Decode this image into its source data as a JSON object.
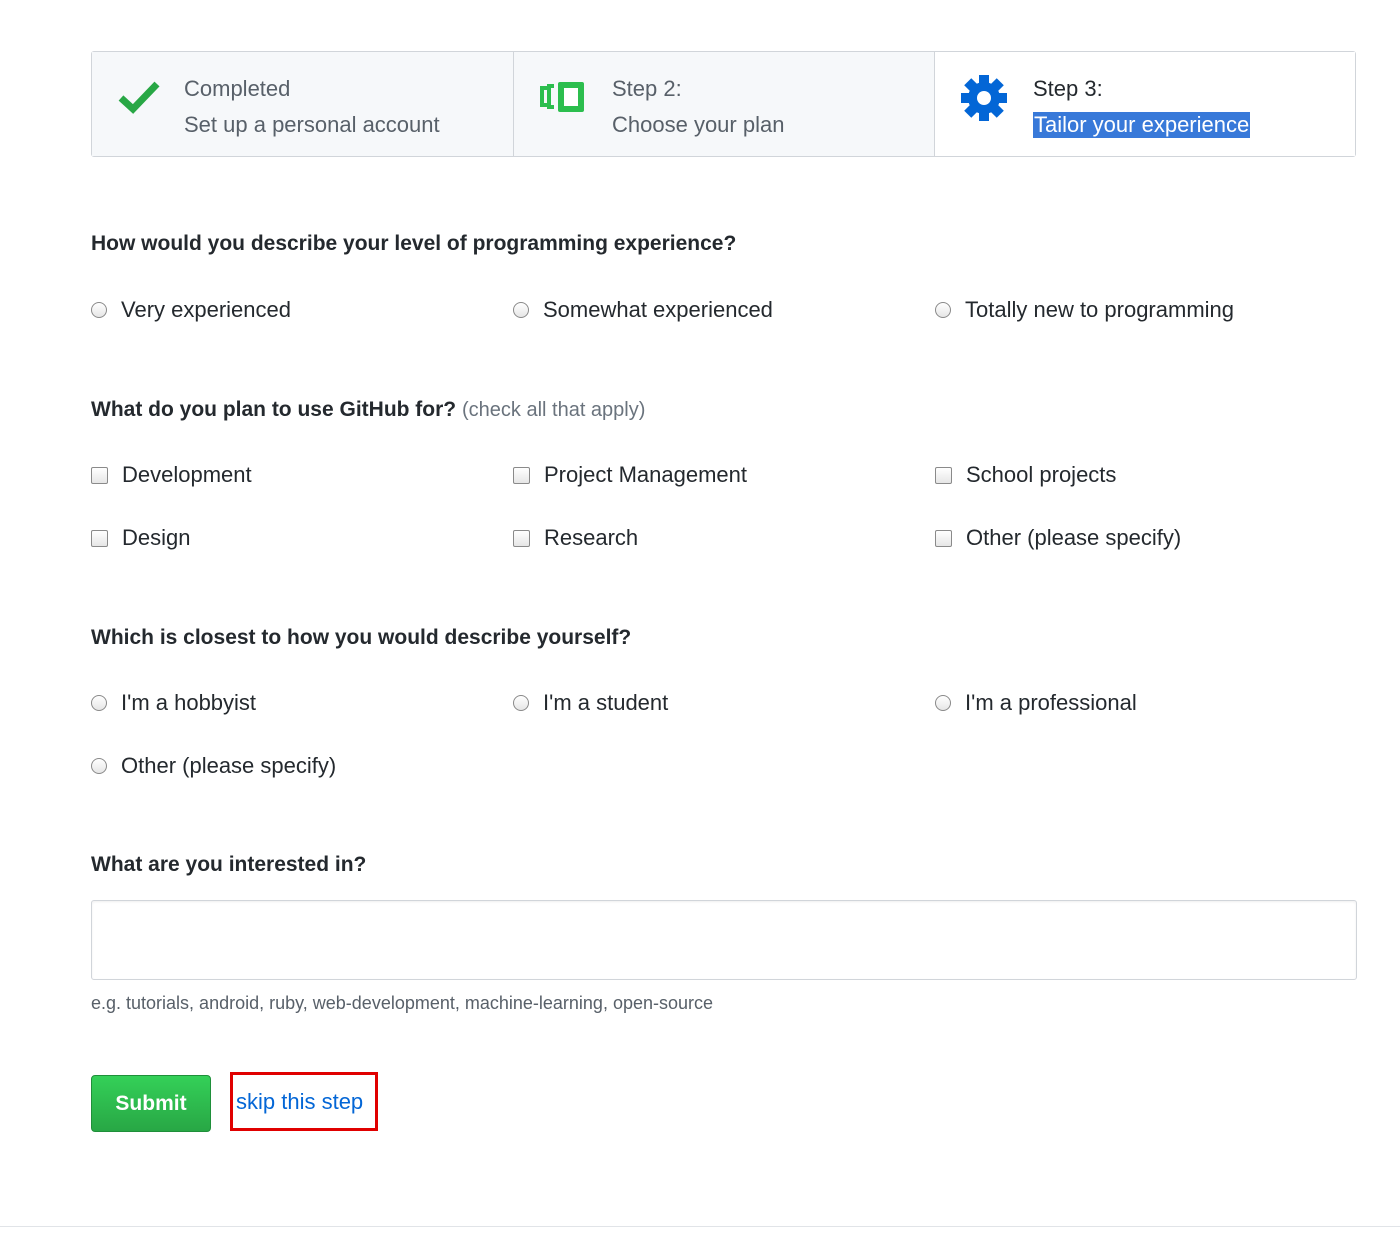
{
  "colors": {
    "success_green": "#28a745",
    "step_icon_green": "#2cbe4e",
    "gear_blue": "#0366d6",
    "link_blue": "#0366d6",
    "highlight_blue": "#3879d9",
    "annotation_red": "#e00000"
  },
  "steps": [
    {
      "title": "Completed",
      "subtitle": "Set up a personal account",
      "icon": "checkmark-icon"
    },
    {
      "title": "Step 2:",
      "subtitle": "Choose your plan",
      "icon": "plan-icon"
    },
    {
      "title": "Step 3:",
      "subtitle": "Tailor your experience",
      "icon": "gear-icon"
    }
  ],
  "q1": {
    "label": "How would you describe your level of programming experience?",
    "options": [
      "Very experienced",
      "Somewhat experienced",
      "Totally new to programming"
    ]
  },
  "q2": {
    "label": "What do you plan to use GitHub for?",
    "hint": "(check all that apply)",
    "options": [
      "Development",
      "Project Management",
      "School projects",
      "Design",
      "Research",
      "Other (please specify)"
    ]
  },
  "q3": {
    "label": "Which is closest to how you would describe yourself?",
    "options": [
      "I'm a hobbyist",
      "I'm a student",
      "I'm a professional",
      "Other (please specify)"
    ]
  },
  "q4": {
    "label": "What are you interested in?",
    "value": "",
    "note": "e.g. tutorials, android, ruby, web-development, machine-learning, open-source"
  },
  "actions": {
    "submit_label": "Submit",
    "skip_label": "skip this step"
  }
}
